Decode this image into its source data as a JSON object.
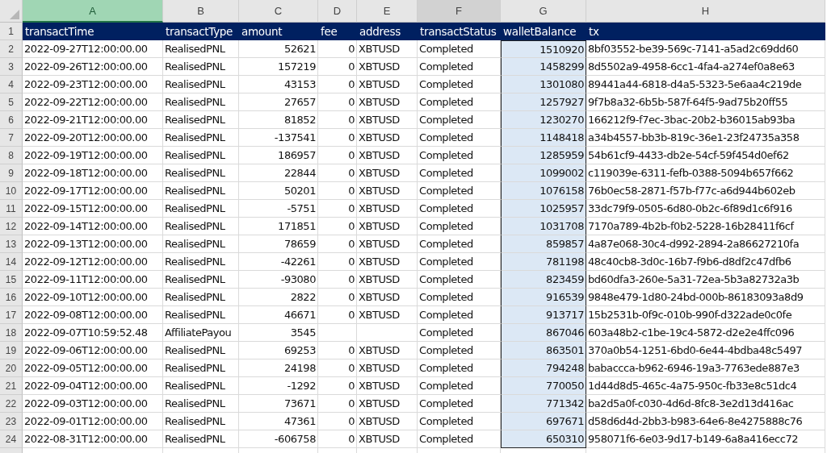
{
  "columns": [
    {
      "letter": "A",
      "selected": true,
      "highlighted": false,
      "numeric": false,
      "range_selected": false
    },
    {
      "letter": "B",
      "selected": false,
      "highlighted": false,
      "numeric": false,
      "range_selected": false
    },
    {
      "letter": "C",
      "selected": false,
      "highlighted": false,
      "numeric": true,
      "range_selected": false
    },
    {
      "letter": "D",
      "selected": false,
      "highlighted": false,
      "numeric": true,
      "range_selected": false
    },
    {
      "letter": "E",
      "selected": false,
      "highlighted": false,
      "numeric": false,
      "range_selected": false
    },
    {
      "letter": "F",
      "selected": false,
      "highlighted": true,
      "numeric": false,
      "range_selected": false
    },
    {
      "letter": "G",
      "selected": false,
      "highlighted": false,
      "numeric": true,
      "range_selected": true
    },
    {
      "letter": "H",
      "selected": false,
      "highlighted": false,
      "numeric": false,
      "range_selected": false
    }
  ],
  "header": {
    "number": "1",
    "cells": [
      "transactTime",
      "transactType",
      "amount",
      "fee",
      "address",
      "transactStatus",
      "walletBalance",
      "tx"
    ]
  },
  "rows": [
    {
      "number": "2",
      "cells": [
        "2022-09-27T12:00:00.00",
        "RealisedPNL",
        "52621",
        "0",
        "XBTUSD",
        "Completed",
        "1510920",
        "8bf03552-be39-569c-7141-a5ad2c69dd60"
      ]
    },
    {
      "number": "3",
      "cells": [
        "2022-09-26T12:00:00.00",
        "RealisedPNL",
        "157219",
        "0",
        "XBTUSD",
        "Completed",
        "1458299",
        "8d5502a9-4958-6cc1-4fa4-a274ef0a8e63"
      ]
    },
    {
      "number": "4",
      "cells": [
        "2022-09-23T12:00:00.00",
        "RealisedPNL",
        "43153",
        "0",
        "XBTUSD",
        "Completed",
        "1301080",
        "89441a44-6818-d4a5-5323-5e6aa4c219de"
      ]
    },
    {
      "number": "5",
      "cells": [
        "2022-09-22T12:00:00.00",
        "RealisedPNL",
        "27657",
        "0",
        "XBTUSD",
        "Completed",
        "1257927",
        "9f7b8a32-6b5b-587f-64f5-9ad75b20ff55"
      ]
    },
    {
      "number": "6",
      "cells": [
        "2022-09-21T12:00:00.00",
        "RealisedPNL",
        "81852",
        "0",
        "XBTUSD",
        "Completed",
        "1230270",
        "166212f9-f7ec-3bac-20b2-b36015ab93ba"
      ]
    },
    {
      "number": "7",
      "cells": [
        "2022-09-20T12:00:00.00",
        "RealisedPNL",
        "-137541",
        "0",
        "XBTUSD",
        "Completed",
        "1148418",
        "a34b4557-bb3b-819c-36e1-23f24735a358"
      ]
    },
    {
      "number": "8",
      "cells": [
        "2022-09-19T12:00:00.00",
        "RealisedPNL",
        "186957",
        "0",
        "XBTUSD",
        "Completed",
        "1285959",
        "54b61cf9-4433-db2e-54cf-59f454d0ef62"
      ]
    },
    {
      "number": "9",
      "cells": [
        "2022-09-18T12:00:00.00",
        "RealisedPNL",
        "22844",
        "0",
        "XBTUSD",
        "Completed",
        "1099002",
        "c119039e-6311-fefb-0388-5094b657f662"
      ]
    },
    {
      "number": "10",
      "cells": [
        "2022-09-17T12:00:00.00",
        "RealisedPNL",
        "50201",
        "0",
        "XBTUSD",
        "Completed",
        "1076158",
        "76b0ec58-2871-f57b-f77c-a6d944b602eb"
      ]
    },
    {
      "number": "11",
      "cells": [
        "2022-09-15T12:00:00.00",
        "RealisedPNL",
        "-5751",
        "0",
        "XBTUSD",
        "Completed",
        "1025957",
        "33dc79f9-0505-6d80-0b2c-6f89d1c6f916"
      ]
    },
    {
      "number": "12",
      "cells": [
        "2022-09-14T12:00:00.00",
        "RealisedPNL",
        "171851",
        "0",
        "XBTUSD",
        "Completed",
        "1031708",
        "7170a789-4b2b-f0b2-5228-16b28411f6cf"
      ]
    },
    {
      "number": "13",
      "cells": [
        "2022-09-13T12:00:00.00",
        "RealisedPNL",
        "78659",
        "0",
        "XBTUSD",
        "Completed",
        "859857",
        "4a87e068-30c4-d992-2894-2a86627210fa"
      ]
    },
    {
      "number": "14",
      "cells": [
        "2022-09-12T12:00:00.00",
        "RealisedPNL",
        "-42261",
        "0",
        "XBTUSD",
        "Completed",
        "781198",
        "48c40cb8-3d0c-16b7-f9b6-d8df2c47dfb6"
      ]
    },
    {
      "number": "15",
      "cells": [
        "2022-09-11T12:00:00.00",
        "RealisedPNL",
        "-93080",
        "0",
        "XBTUSD",
        "Completed",
        "823459",
        "bd60dfa3-260e-5a31-72ea-5b3a82732a3b"
      ]
    },
    {
      "number": "16",
      "cells": [
        "2022-09-10T12:00:00.00",
        "RealisedPNL",
        "2822",
        "0",
        "XBTUSD",
        "Completed",
        "916539",
        "9848e479-1d80-24bd-000b-86183093a8d9"
      ]
    },
    {
      "number": "17",
      "cells": [
        "2022-09-08T12:00:00.00",
        "RealisedPNL",
        "46671",
        "0",
        "XBTUSD",
        "Completed",
        "913717",
        "15b2531b-0f9c-010b-990f-d322ade0c0fe"
      ]
    },
    {
      "number": "18",
      "cells": [
        "2022-09-07T10:59:52.48",
        "AffiliatePayou",
        "3545",
        null,
        null,
        "Completed",
        "867046",
        "603a48b2-c1be-19c4-5872-d2e2e4ffc096"
      ]
    },
    {
      "number": "19",
      "cells": [
        "2022-09-06T12:00:00.00",
        "RealisedPNL",
        "69253",
        "0",
        "XBTUSD",
        "Completed",
        "863501",
        "370a0b54-1251-6bd0-6e44-4bdba48c5497"
      ]
    },
    {
      "number": "20",
      "cells": [
        "2022-09-05T12:00:00.00",
        "RealisedPNL",
        "24198",
        "0",
        "XBTUSD",
        "Completed",
        "794248",
        "babaccca-b962-6946-19a3-7763ede887e3"
      ]
    },
    {
      "number": "21",
      "cells": [
        "2022-09-04T12:00:00.00",
        "RealisedPNL",
        "-1292",
        "0",
        "XBTUSD",
        "Completed",
        "770050",
        "1d44d8d5-465c-4a75-950c-fb33e8c51dc4"
      ]
    },
    {
      "number": "22",
      "cells": [
        "2022-09-03T12:00:00.00",
        "RealisedPNL",
        "73671",
        "0",
        "XBTUSD",
        "Completed",
        "771342",
        "ba2d5a0f-c030-4d6d-8fc8-3e2d13d416ac"
      ]
    },
    {
      "number": "23",
      "cells": [
        "2022-09-01T12:00:00.00",
        "RealisedPNL",
        "47361",
        "0",
        "XBTUSD",
        "Completed",
        "697671",
        "d58d6d4d-2bb3-b983-64e6-8e4275888c76"
      ]
    },
    {
      "number": "24",
      "cells": [
        "2022-08-31T12:00:00.00",
        "RealisedPNL",
        "-606758",
        "0",
        "XBTUSD",
        "Completed",
        "650310",
        "958071f6-6e03-9d17-b149-6a8a416ecc72"
      ]
    }
  ]
}
